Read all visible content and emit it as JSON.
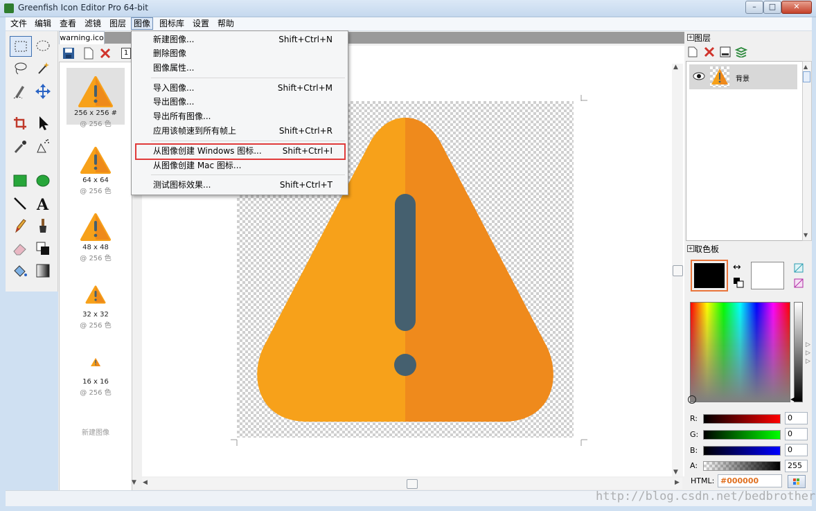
{
  "window": {
    "title": "Greenfish Icon Editor Pro 64-bit",
    "min": "–",
    "max": "□",
    "close": "✕"
  },
  "menubar": [
    "文件",
    "编辑",
    "查看",
    "滤镜",
    "图层",
    "图像",
    "图标库",
    "设置",
    "帮助"
  ],
  "document": {
    "tab": "warning.ico"
  },
  "thumbnails": [
    {
      "size": "256 x 256 #",
      "colors": "@ 256 色"
    },
    {
      "size": "64 x 64",
      "colors": "@ 256 色"
    },
    {
      "size": "48 x 48",
      "colors": "@ 256 色"
    },
    {
      "size": "32 x 32",
      "colors": "@ 256 色"
    },
    {
      "size": "16 x 16",
      "colors": "@ 256 色"
    }
  ],
  "new_image_label": "新建图像",
  "image_menu": {
    "items": [
      {
        "label": "新建图像...",
        "shortcut": "Shift+Ctrl+N"
      },
      {
        "label": "删除图像",
        "shortcut": ""
      },
      {
        "label": "图像属性...",
        "shortcut": ""
      },
      {
        "label": "导入图像...",
        "shortcut": "Shift+Ctrl+M"
      },
      {
        "label": "导出图像...",
        "shortcut": ""
      },
      {
        "label": "导出所有图像...",
        "shortcut": ""
      },
      {
        "label": "应用该帧速到所有帧上",
        "shortcut": "Shift+Ctrl+R"
      },
      {
        "label": "从图像创建 Windows 图标...",
        "shortcut": "Shift+Ctrl+I"
      },
      {
        "label": "从图像创建 Mac 图标...",
        "shortcut": ""
      },
      {
        "label": "测试图标效果...",
        "shortcut": "Shift+Ctrl+T"
      }
    ]
  },
  "layers": {
    "title": "图层",
    "layer_name": "背景"
  },
  "palette": {
    "title": "取色板",
    "r_label": "R:",
    "r_value": "0",
    "g_label": "G:",
    "g_value": "0",
    "b_label": "B:",
    "b_value": "0",
    "a_label": "A:",
    "a_value": "255",
    "html_label": "HTML:",
    "html_value": "#000000"
  },
  "watermark": "http://blog.csdn.net/bedbrother",
  "colors": {
    "accent_orange": "#F7A11A",
    "exclamation": "#45606F",
    "highlight_red": "#E03A3A"
  }
}
